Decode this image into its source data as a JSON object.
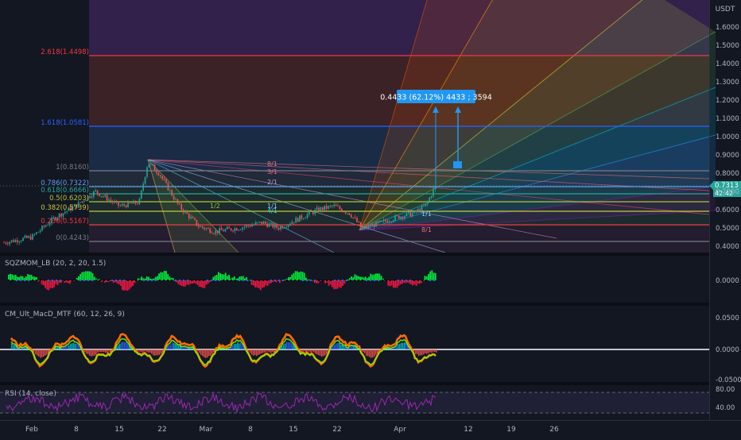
{
  "currency": "USDT",
  "price_axis": [
    "1.6000",
    "1.5000",
    "1.4000",
    "1.3000",
    "1.2000",
    "1.1000",
    "1.0000",
    "0.9000",
    "0.8000",
    "0.7000",
    "0.6000",
    "0.5000",
    "0.4000"
  ],
  "current_price": {
    "value": "0.7313",
    "countdown": "42:42",
    "color": "#26a69a"
  },
  "fib_levels": [
    {
      "label": "2.618(1.4498)",
      "color": "#f23645"
    },
    {
      "label": "1.618(1.0581)",
      "color": "#2962ff"
    },
    {
      "label": "1(0.8160)",
      "color": "#787b86"
    },
    {
      "label": "0.786(0.7322)",
      "color": "#5ba0f0"
    },
    {
      "label": "0.618(0.6666)",
      "color": "#26a69a"
    },
    {
      "label": "0.5(0.6203)",
      "color": "#b2c23a"
    },
    {
      "label": "0.382(0.5739)",
      "color": "#c8c83c"
    },
    {
      "label": "0.236(0.5167)",
      "color": "#f23645"
    },
    {
      "label": "0(0.4243)",
      "color": "#787b86"
    }
  ],
  "measure_tooltip": "0.4433 (62.12%) 4433 ; 3594",
  "gann_labels": [
    "8/1",
    "3/1",
    "2/1",
    "1/1",
    "4/1",
    "1/2",
    "1/1",
    "8/1"
  ],
  "indicators": {
    "sqz": {
      "title": "SQZMOM_LB (20, 2, 20, 1.5)",
      "axis": [
        "0.0000"
      ]
    },
    "macd": {
      "title": "CM_Ult_MacD_MTF (60, 12, 26, 9)",
      "axis": [
        "0.0500",
        "0.0000",
        "-0.0500"
      ]
    },
    "rsi": {
      "title": "RSI (14, close)",
      "axis": [
        "80.00",
        "40.00"
      ]
    }
  },
  "time_axis": [
    "Feb",
    "8",
    "15",
    "22",
    "Mar",
    "8",
    "15",
    "22",
    "Apr",
    "12",
    "19",
    "26"
  ],
  "colors": {
    "bg": "#131722",
    "up": "#26a69a",
    "down": "#ef5350",
    "lime": "#00ff3c",
    "rsi": "#9c27b0"
  }
}
